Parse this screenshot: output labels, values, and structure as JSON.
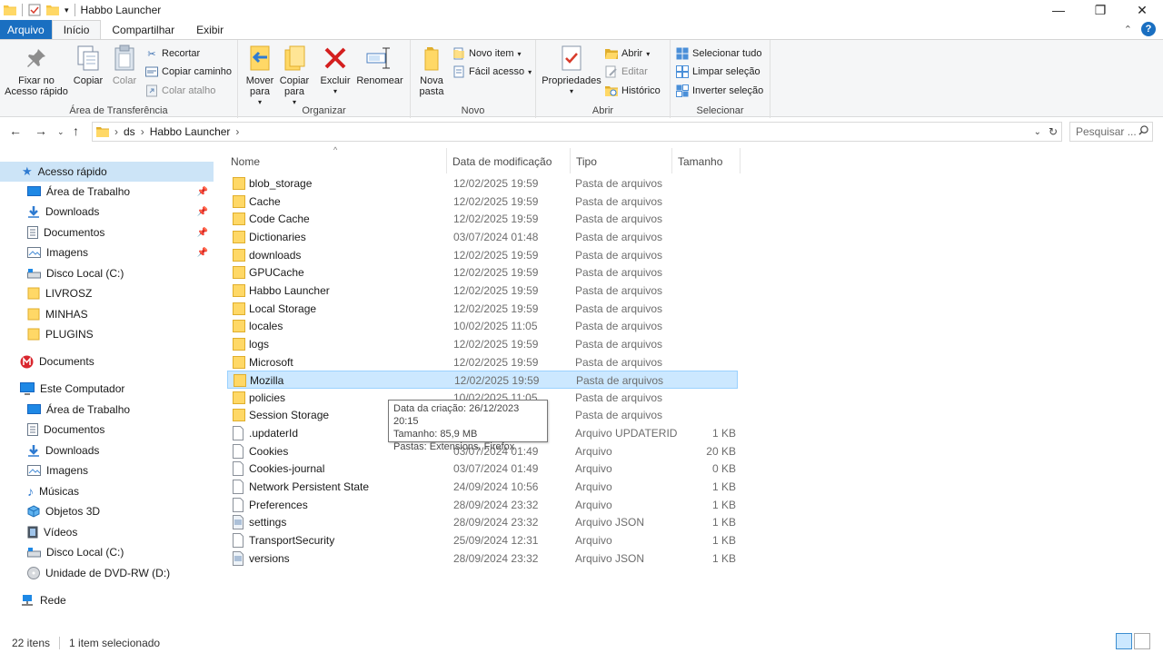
{
  "window": {
    "title": "Habbo Launcher"
  },
  "tabs": {
    "file": "Arquivo",
    "home": "Início",
    "share": "Compartilhar",
    "view": "Exibir"
  },
  "ribbon": {
    "clipboard": {
      "label": "Área de Transferência",
      "pin": "Fixar no Acesso rápido",
      "copy": "Copiar",
      "paste": "Colar",
      "cut": "Recortar",
      "copy_path": "Copiar caminho",
      "paste_shortcut": "Colar atalho"
    },
    "organize": {
      "label": "Organizar",
      "move_to": "Mover para",
      "copy_to": "Copiar para",
      "delete": "Excluir",
      "rename": "Renomear"
    },
    "new": {
      "label": "Novo",
      "new_folder": "Nova pasta",
      "new_item": "Novo item",
      "easy_access": "Fácil acesso"
    },
    "open": {
      "label": "Abrir",
      "properties": "Propriedades",
      "open": "Abrir",
      "edit": "Editar",
      "history": "Histórico"
    },
    "select": {
      "label": "Selecionar",
      "select_all": "Selecionar tudo",
      "clear_selection": "Limpar seleção",
      "invert_selection": "Inverter seleção"
    }
  },
  "address": {
    "crumbs": [
      "ds",
      "Habbo Launcher"
    ],
    "search_placeholder": "Pesquisar ..."
  },
  "nav": {
    "quick_access": "Acesso rápido",
    "quick_items": [
      "Área de Trabalho",
      "Downloads",
      "Documentos",
      "Imagens",
      "Disco Local (C:)",
      "LIVROSZ",
      "MINHAS",
      "PLUGINS"
    ],
    "mega": "Documents",
    "this_pc": "Este Computador",
    "pc_items": [
      "Área de Trabalho",
      "Documentos",
      "Downloads",
      "Imagens",
      "Músicas",
      "Objetos 3D",
      "Vídeos",
      "Disco Local (C:)",
      "Unidade de DVD-RW (D:)"
    ],
    "network": "Rede"
  },
  "columns": {
    "name": "Nome",
    "date": "Data de modificação",
    "type": "Tipo",
    "size": "Tamanho"
  },
  "files": [
    {
      "name": "blob_storage",
      "date": "12/02/2025 19:59",
      "type": "Pasta de arquivos",
      "size": "",
      "kind": "folder"
    },
    {
      "name": "Cache",
      "date": "12/02/2025 19:59",
      "type": "Pasta de arquivos",
      "size": "",
      "kind": "folder"
    },
    {
      "name": "Code Cache",
      "date": "12/02/2025 19:59",
      "type": "Pasta de arquivos",
      "size": "",
      "kind": "folder"
    },
    {
      "name": "Dictionaries",
      "date": "03/07/2024 01:48",
      "type": "Pasta de arquivos",
      "size": "",
      "kind": "folder"
    },
    {
      "name": "downloads",
      "date": "12/02/2025 19:59",
      "type": "Pasta de arquivos",
      "size": "",
      "kind": "folder"
    },
    {
      "name": "GPUCache",
      "date": "12/02/2025 19:59",
      "type": "Pasta de arquivos",
      "size": "",
      "kind": "folder"
    },
    {
      "name": "Habbo Launcher",
      "date": "12/02/2025 19:59",
      "type": "Pasta de arquivos",
      "size": "",
      "kind": "folder"
    },
    {
      "name": "Local Storage",
      "date": "12/02/2025 19:59",
      "type": "Pasta de arquivos",
      "size": "",
      "kind": "folder"
    },
    {
      "name": "locales",
      "date": "10/02/2025 11:05",
      "type": "Pasta de arquivos",
      "size": "",
      "kind": "folder"
    },
    {
      "name": "logs",
      "date": "12/02/2025 19:59",
      "type": "Pasta de arquivos",
      "size": "",
      "kind": "folder"
    },
    {
      "name": "Microsoft",
      "date": "12/02/2025 19:59",
      "type": "Pasta de arquivos",
      "size": "",
      "kind": "folder"
    },
    {
      "name": "Mozilla",
      "date": "12/02/2025 19:59",
      "type": "Pasta de arquivos",
      "size": "",
      "kind": "folder",
      "selected": true
    },
    {
      "name": "policies",
      "date": "10/02/2025 11:05",
      "type": "Pasta de arquivos",
      "size": "",
      "kind": "folder"
    },
    {
      "name": "Session Storage",
      "date": "",
      "type": "Pasta de arquivos",
      "size": "",
      "kind": "folder"
    },
    {
      "name": ".updaterId",
      "date": "",
      "type": "Arquivo UPDATERID",
      "size": "1 KB",
      "kind": "file"
    },
    {
      "name": "Cookies",
      "date": "03/07/2024 01:49",
      "type": "Arquivo",
      "size": "20 KB",
      "kind": "file"
    },
    {
      "name": "Cookies-journal",
      "date": "03/07/2024 01:49",
      "type": "Arquivo",
      "size": "0 KB",
      "kind": "file"
    },
    {
      "name": "Network Persistent State",
      "date": "24/09/2024 10:56",
      "type": "Arquivo",
      "size": "1 KB",
      "kind": "file"
    },
    {
      "name": "Preferences",
      "date": "28/09/2024 23:32",
      "type": "Arquivo",
      "size": "1 KB",
      "kind": "file"
    },
    {
      "name": "settings",
      "date": "28/09/2024 23:32",
      "type": "Arquivo JSON",
      "size": "1 KB",
      "kind": "json"
    },
    {
      "name": "TransportSecurity",
      "date": "25/09/2024 12:31",
      "type": "Arquivo",
      "size": "1 KB",
      "kind": "file"
    },
    {
      "name": "versions",
      "date": "28/09/2024 23:32",
      "type": "Arquivo JSON",
      "size": "1 KB",
      "kind": "json"
    }
  ],
  "tooltip": {
    "line1": "Data da criação: 26/12/2023 20:15",
    "line2": "Tamanho: 85,9 MB",
    "line3": "Pastas: Extensions, Firefox"
  },
  "status": {
    "count": "22 itens",
    "selected": "1 item selecionado"
  }
}
